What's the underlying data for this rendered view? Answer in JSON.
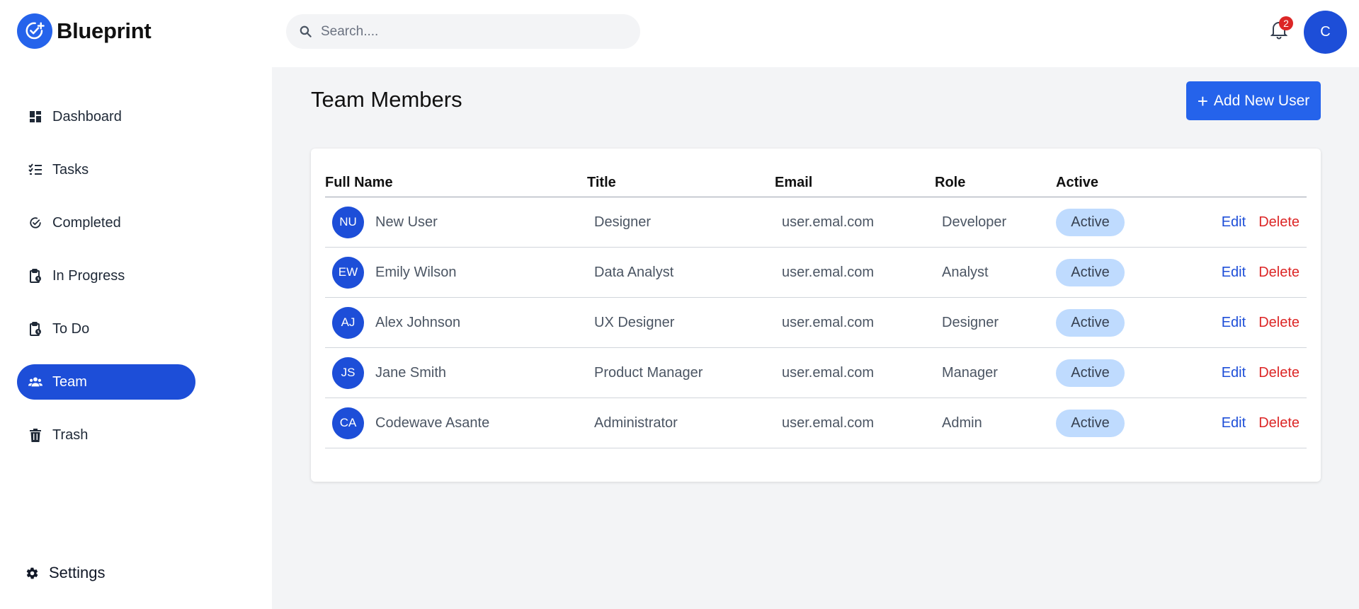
{
  "app": {
    "name": "Blueprint"
  },
  "sidebar": {
    "items": [
      {
        "label": "Dashboard",
        "icon": "dashboard-icon",
        "active": false
      },
      {
        "label": "Tasks",
        "icon": "tasks-list-icon",
        "active": false
      },
      {
        "label": "Completed",
        "icon": "check-circle-icon",
        "active": false
      },
      {
        "label": "In Progress",
        "icon": "clipboard-clock-icon",
        "active": false
      },
      {
        "label": "To Do",
        "icon": "clipboard-clock-icon",
        "active": false
      },
      {
        "label": "Team",
        "icon": "users-icon",
        "active": true
      },
      {
        "label": "Trash",
        "icon": "trash-icon",
        "active": false
      }
    ],
    "settings_label": "Settings"
  },
  "header": {
    "search_placeholder": "Search....",
    "notification_count": "2",
    "user_initial": "C"
  },
  "main": {
    "title": "Team Members",
    "add_button_label": "Add New User",
    "table": {
      "headers": [
        "Full Name",
        "Title",
        "Email",
        "Role",
        "Active"
      ],
      "rows": [
        {
          "initials": "NU",
          "name": "New User",
          "title": "Designer",
          "email": "user.emal.com",
          "role": "Developer",
          "status": "Active",
          "edit": "Edit",
          "delete": "Delete"
        },
        {
          "initials": "EW",
          "name": "Emily Wilson",
          "title": "Data Analyst",
          "email": "user.emal.com",
          "role": "Analyst",
          "status": "Active",
          "edit": "Edit",
          "delete": "Delete"
        },
        {
          "initials": "AJ",
          "name": "Alex Johnson",
          "title": "UX Designer",
          "email": "user.emal.com",
          "role": "Designer",
          "status": "Active",
          "edit": "Edit",
          "delete": "Delete"
        },
        {
          "initials": "JS",
          "name": "Jane Smith",
          "title": "Product Manager",
          "email": "user.emal.com",
          "role": "Manager",
          "status": "Active",
          "edit": "Edit",
          "delete": "Delete"
        },
        {
          "initials": "CA",
          "name": "Codewave Asante",
          "title": "Administrator",
          "email": "user.emal.com",
          "role": "Admin",
          "status": "Active",
          "edit": "Edit",
          "delete": "Delete"
        }
      ]
    }
  },
  "colors": {
    "accent": "#2563eb",
    "accent_dark": "#1d4ed8",
    "danger": "#dc2626",
    "status_bg": "#bfdbfe",
    "main_bg": "#f3f4f6"
  }
}
